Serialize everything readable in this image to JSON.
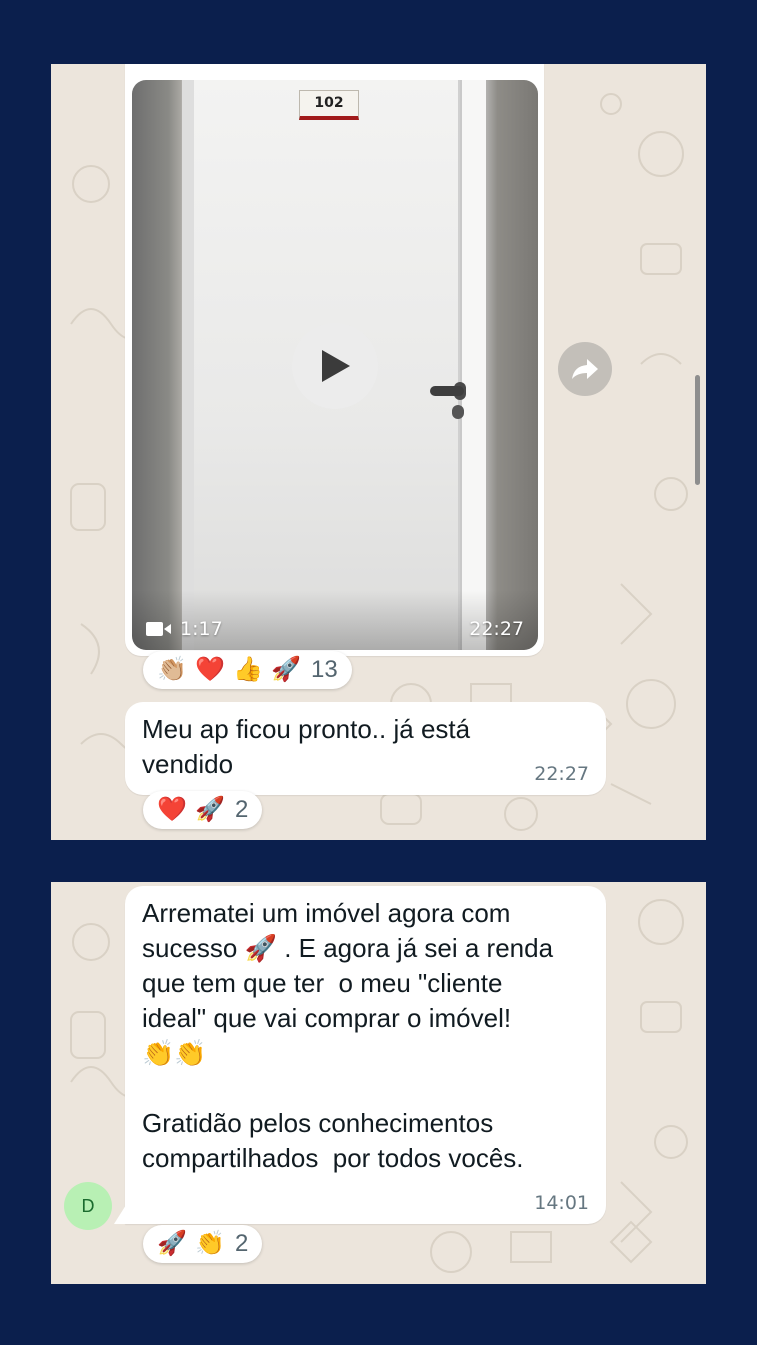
{
  "panel_one": {
    "video_message": {
      "room_plate": "102",
      "duration": "1:17",
      "timestamp": "22:27",
      "icons": [
        "play-icon",
        "video-camera-icon",
        "forward-icon"
      ],
      "reactions": {
        "emojis": [
          "👏🏼",
          "❤️",
          "👍",
          "🚀"
        ],
        "count": "13"
      }
    },
    "text_message": {
      "text": "Meu ap ficou pronto.. já está\nvendido",
      "timestamp": "22:27",
      "reactions": {
        "emojis": [
          "❤️",
          "🚀"
        ],
        "count": "2"
      }
    }
  },
  "panel_two": {
    "sender_initial": "D",
    "text_message": {
      "text": "Arrematei um imóvel agora com\nsucesso 🚀 . E agora já sei a renda\nque tem que ter  o meu \"cliente\nideal\" que vai comprar o imóvel!\n👏👏\n\nGratidão pelos conhecimentos\ncompartilhados  por todos vocês.",
      "timestamp": "14:01",
      "reactions": {
        "emojis": [
          "🚀",
          "👏"
        ],
        "count": "2"
      }
    }
  },
  "colors": {
    "page_background": "#0b1f4d",
    "chat_wallpaper": "#ece5dc",
    "bubble": "#ffffff",
    "avatar": "#b8f0b4"
  }
}
